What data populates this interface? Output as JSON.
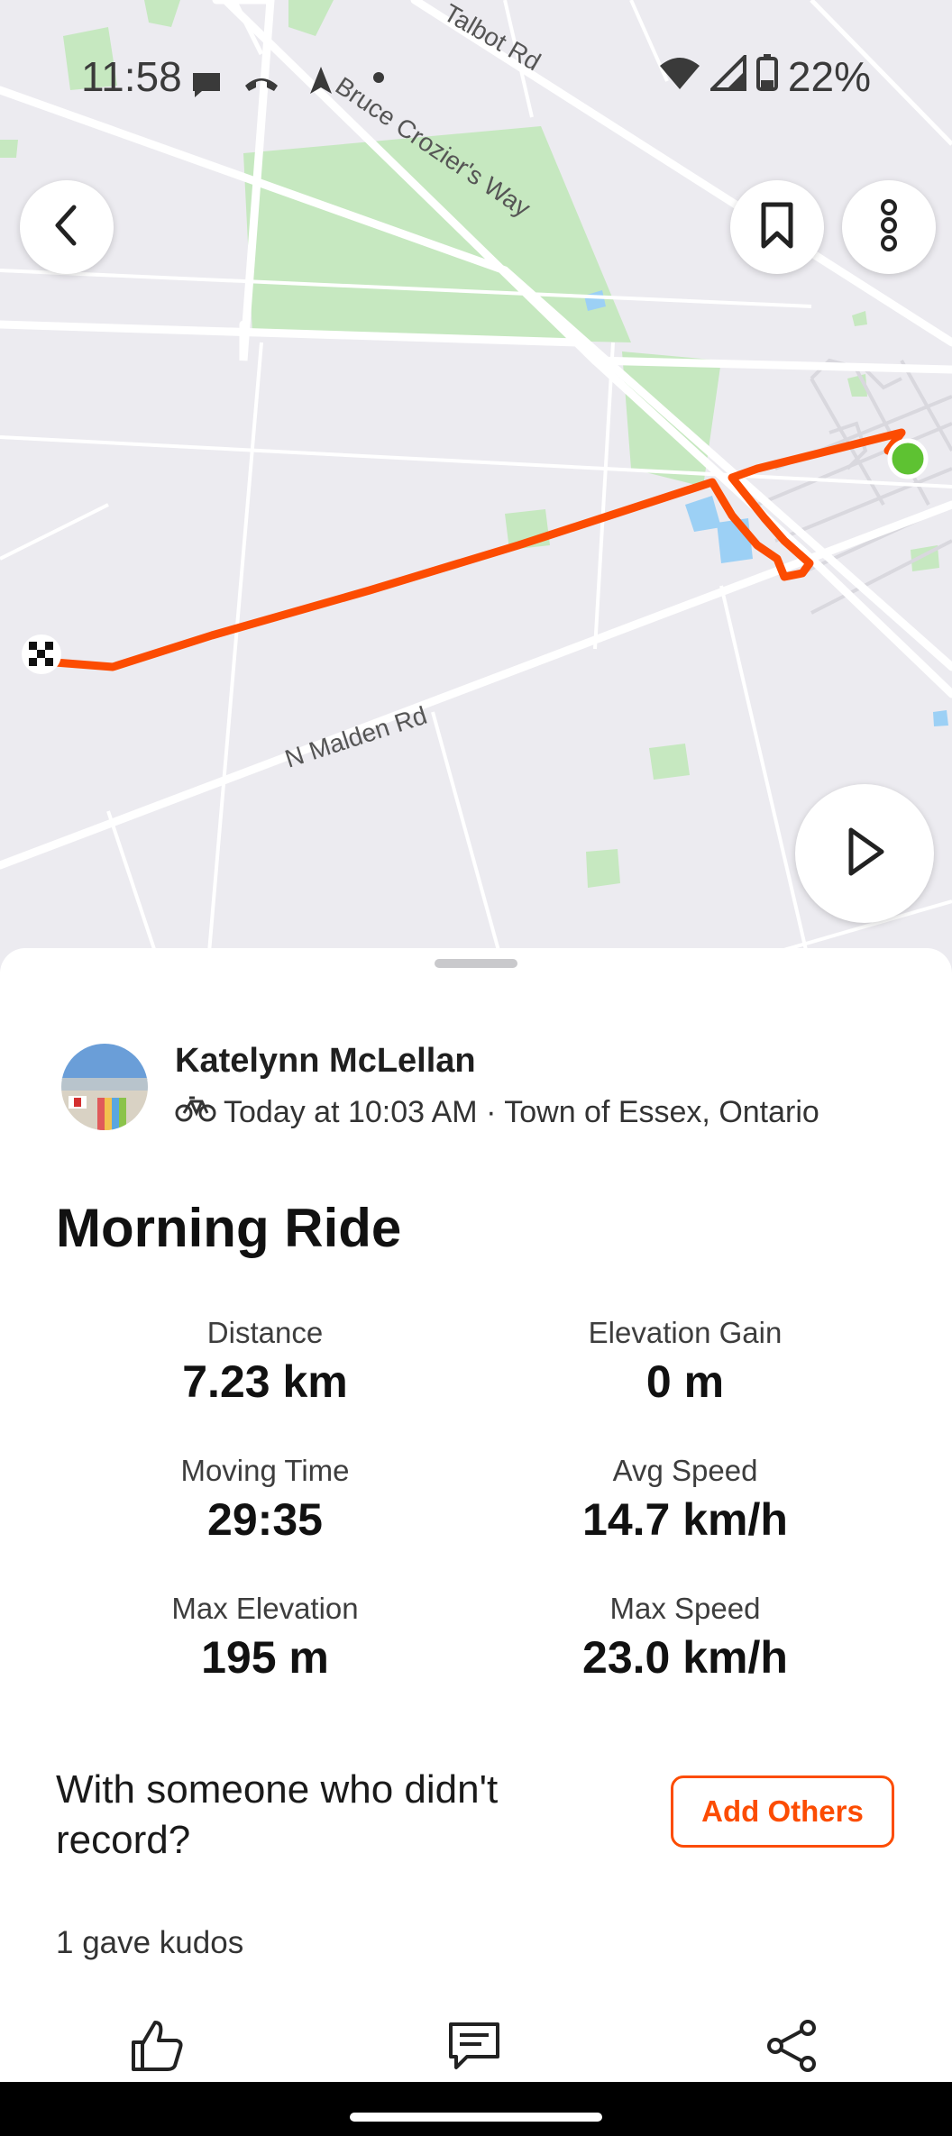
{
  "status_bar": {
    "time": "11:58",
    "battery": "22%",
    "icons": [
      "message-icon",
      "call-icon",
      "navigation-icon",
      "dot-icon",
      "wifi-icon",
      "signal-icon",
      "battery-icon"
    ]
  },
  "map": {
    "roads": {
      "talbot": "Talbot Rd",
      "bruce": "Bruce Crozier's Way",
      "malden": "N Malden Rd"
    },
    "colors": {
      "route": "#fc4c02",
      "start": "#5ec232",
      "park": "#c6e8c0",
      "water": "#9cd0f5"
    }
  },
  "map_controls": {
    "back_icon": "chevron-left-icon",
    "save_icon": "bookmark-icon",
    "more_icon": "more-vertical-icon",
    "play_icon": "play-icon"
  },
  "activity": {
    "athlete_name": "Katelynn McLellan",
    "sport_icon": "bike-icon",
    "meta": "Today at 10:03 AM · Town of Essex, Ontario",
    "title": "Morning Ride"
  },
  "stats": [
    {
      "label": "Distance",
      "value": "7.23 km"
    },
    {
      "label": "Elevation Gain",
      "value": "0 m"
    },
    {
      "label": "Moving Time",
      "value": "29:35"
    },
    {
      "label": "Avg Speed",
      "value": "14.7 km/h"
    },
    {
      "label": "Max Elevation",
      "value": "195 m"
    },
    {
      "label": "Max Speed",
      "value": "23.0 km/h"
    }
  ],
  "with_others": {
    "prompt": "With someone who didn't record?",
    "button_label": "Add Others"
  },
  "kudos": {
    "text": "1 gave kudos"
  },
  "actions": {
    "kudos_icon": "thumbs-up-icon",
    "comment_icon": "comment-icon",
    "share_icon": "share-icon"
  },
  "accent_color": "#fc4c02"
}
